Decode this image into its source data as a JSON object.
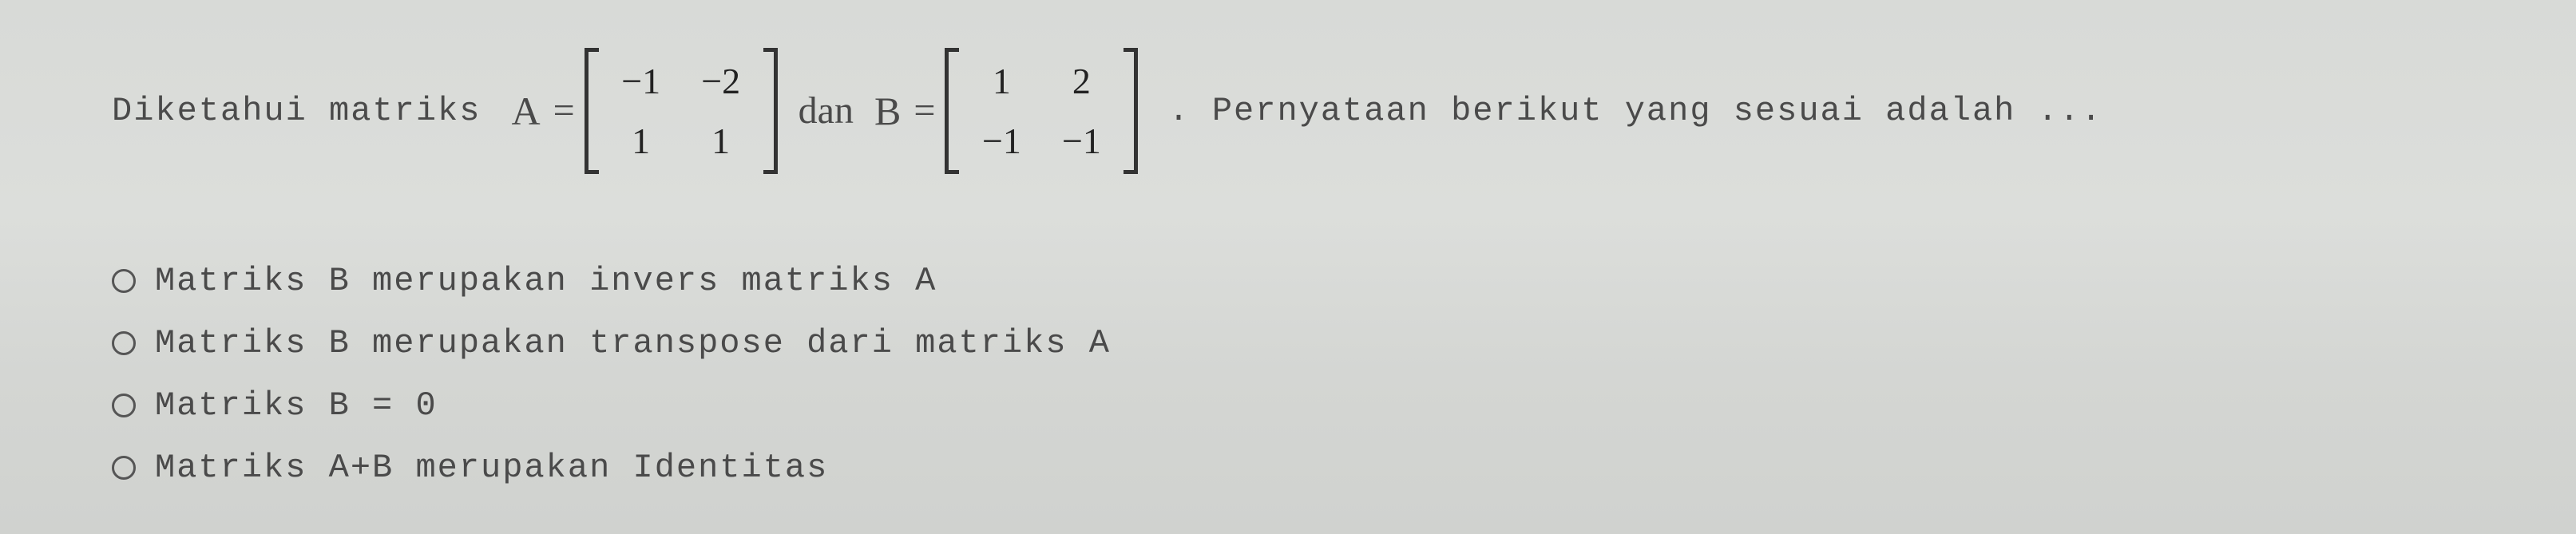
{
  "question": {
    "prefix": "Diketahui matriks",
    "matrixA": {
      "name": "A",
      "r1c1": "−1",
      "r1c2": "−2",
      "r2c1": "1",
      "r2c2": "1"
    },
    "dan": "dan",
    "matrixB": {
      "name": "B",
      "r1c1": "1",
      "r1c2": "2",
      "r2c1": "−1",
      "r2c2": "−1"
    },
    "suffix": ". Pernyataan berikut yang sesuai adalah ..."
  },
  "options": {
    "a": "Matriks B merupakan invers matriks A",
    "b": "Matriks B merupakan transpose dari matriks A",
    "c": "Matriks B = 0",
    "d": "Matriks A+B merupakan Identitas"
  }
}
